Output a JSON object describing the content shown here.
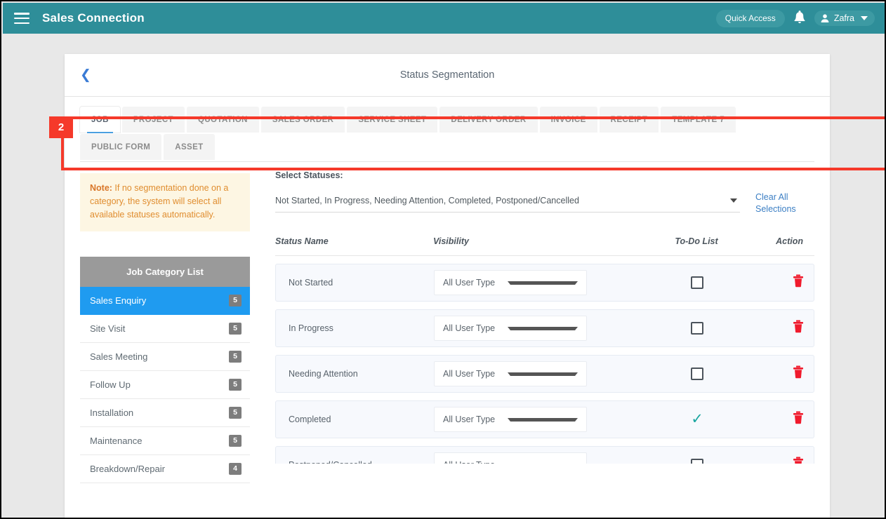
{
  "topbar": {
    "menu_icon": "hamburger-icon",
    "app_title": "Sales Connection",
    "quick_access_label": "Quick Access",
    "bell_icon": "bell-icon",
    "user_name": "Zafra",
    "user_icon": "person-icon",
    "background_color": "#2e8e99"
  },
  "page": {
    "back_icon": "chevron-left-icon",
    "title": "Status Segmentation"
  },
  "annotation": {
    "badge_number": "2",
    "color": "#f5392a"
  },
  "tabs": [
    {
      "label": "JOB",
      "active": true
    },
    {
      "label": "PROJECT",
      "active": false
    },
    {
      "label": "QUOTATION",
      "active": false
    },
    {
      "label": "SALES ORDER",
      "active": false
    },
    {
      "label": "SERVICE SHEET",
      "active": false
    },
    {
      "label": "DELIVERY ORDER",
      "active": false
    },
    {
      "label": "INVOICE",
      "active": false
    },
    {
      "label": "RECEIPT",
      "active": false
    },
    {
      "label": "TEMPLATE 7",
      "active": false
    },
    {
      "label": "PUBLIC FORM",
      "active": false
    },
    {
      "label": "ASSET",
      "active": false
    }
  ],
  "note": {
    "prefix": "Note:",
    "text": " If no segmentation done on a category, the system will select all available statuses automatically."
  },
  "statuses_selector": {
    "label": "Select Statuses:",
    "value": "Not Started, In Progress, Needing Attention, Completed, Postponed/Cancelled",
    "clear_link": "Clear All Selections"
  },
  "category_list": {
    "header": "Job Category List",
    "items": [
      {
        "label": "Sales Enquiry",
        "count": "5",
        "active": true
      },
      {
        "label": "Site Visit",
        "count": "5",
        "active": false
      },
      {
        "label": "Sales Meeting",
        "count": "5",
        "active": false
      },
      {
        "label": "Follow Up",
        "count": "5",
        "active": false
      },
      {
        "label": "Installation",
        "count": "5",
        "active": false
      },
      {
        "label": "Maintenance",
        "count": "5",
        "active": false
      },
      {
        "label": "Breakdown/Repair",
        "count": "4",
        "active": false
      }
    ]
  },
  "table": {
    "headers": {
      "status_name": "Status Name",
      "visibility": "Visibility",
      "todo_list": "To-Do List",
      "action": "Action"
    },
    "rows": [
      {
        "status": "Not Started",
        "visibility": "All User Type",
        "todo_checked": false,
        "action_icon": "trash-icon"
      },
      {
        "status": "In Progress",
        "visibility": "All User Type",
        "todo_checked": false,
        "action_icon": "trash-icon"
      },
      {
        "status": "Needing Attention",
        "visibility": "All User Type",
        "todo_checked": false,
        "action_icon": "trash-icon"
      },
      {
        "status": "Completed",
        "visibility": "All User Type",
        "todo_checked": true,
        "action_icon": "trash-icon"
      },
      {
        "status": "Postponed/Cancelled",
        "visibility": "All User Type",
        "todo_checked": false,
        "action_icon": "trash-icon"
      }
    ]
  }
}
